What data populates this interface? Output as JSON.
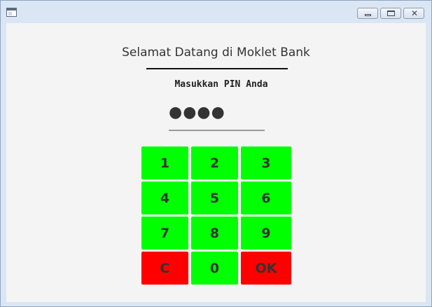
{
  "welcome_title": "Selamat Datang di Moklet Bank",
  "pin_prompt": "Masukkan PIN Anda",
  "pin_value": "●●●●",
  "keypad": {
    "k1": "1",
    "k2": "2",
    "k3": "3",
    "k4": "4",
    "k5": "5",
    "k6": "6",
    "k7": "7",
    "k8": "8",
    "k9": "9",
    "clear": "C",
    "k0": "0",
    "ok": "OK"
  },
  "colors": {
    "digit_key": "#00ff00",
    "action_key": "#ff0000",
    "background": "#f4f4f4"
  },
  "icons": {
    "window": "app-window-icon",
    "minimize": "minimize-icon",
    "maximize": "maximize-icon",
    "close": "close-icon"
  }
}
